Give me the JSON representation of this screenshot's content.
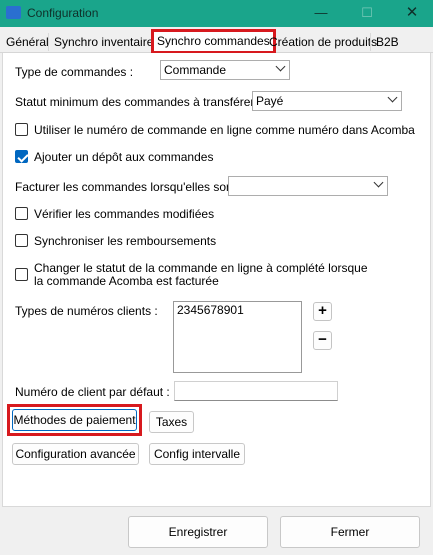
{
  "window": {
    "title": "Configuration",
    "controls": {
      "minimize": "—",
      "maximize": "☐",
      "close": "✕"
    }
  },
  "tabs": [
    {
      "label": "Général"
    },
    {
      "label": "Synchro inventaires"
    },
    {
      "label": "Synchro commandes",
      "active": true
    },
    {
      "label": "Création de produits"
    },
    {
      "label": "B2B"
    }
  ],
  "form": {
    "type_commandes": {
      "label": "Type de commandes :",
      "value": "Commande"
    },
    "statut_minimum": {
      "label": "Statut minimum des commandes à transférer :",
      "value": "Payé"
    },
    "utiliser_numero": {
      "label": "Utiliser le numéro de commande en ligne comme numéro dans Acomba",
      "checked": false
    },
    "ajouter_depot": {
      "label": "Ajouter un dépôt aux commandes",
      "checked": true
    },
    "facturer": {
      "label": "Facturer les commandes lorsqu'elles sont :",
      "value": ""
    },
    "verifier_modifiees": {
      "label": "Vérifier les commandes modifiées",
      "checked": false
    },
    "synchroniser_remboursements": {
      "label": "Synchroniser les remboursements",
      "checked": false
    },
    "changer_statut": {
      "label_line1": "Changer le statut de la commande en ligne à complété lorsque",
      "label_line2": "la commande Acomba est facturée",
      "checked": false
    },
    "types_numeros": {
      "label": "Types de numéros clients :",
      "items": [
        "2345678901"
      ],
      "add": "+",
      "remove": "−"
    },
    "numero_client_defaut": {
      "label": "Numéro de client par défaut :",
      "value": ""
    }
  },
  "buttons": {
    "methodes_paiement": "Méthodes de paiement",
    "taxes": "Taxes",
    "configuration_avancee": "Configuration avancée",
    "config_intervalle": "Config intervalle"
  },
  "footer": {
    "save": "Enregistrer",
    "close": "Fermer"
  }
}
